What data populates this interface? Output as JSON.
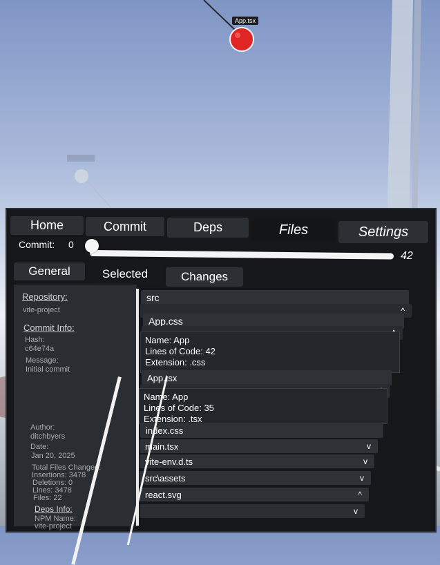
{
  "scene": {
    "node_label": "App.tsx",
    "node_color": "#e02525"
  },
  "nav": {
    "home": "Home",
    "commit": "Commit",
    "deps": "Deps",
    "files": "Files",
    "settings": "Settings"
  },
  "commit_slider": {
    "label": "Commit:",
    "value": "0",
    "max": "42",
    "progress": 0
  },
  "sub_tabs": {
    "general": "General",
    "selected": "Selected",
    "changes": "Changes"
  },
  "info": {
    "repository_heading": "Repository:",
    "repository_name": "vite-project",
    "commit_info_heading": "Commit Info:",
    "hash_label": "Hash:",
    "hash_value": "c64e74a",
    "message_label": "Message:",
    "message_value": "Initial commit",
    "author_label": "Author:",
    "author_value": "ditchbyers",
    "date_label": "Date:",
    "date_value": "Jan 20, 2025",
    "total_files_changed": "Total Files Changed:",
    "insertions": "Insertions: 3478",
    "deletions": "Deletions: 0",
    "lines": "Lines: 3478",
    "files": "Files: 22",
    "deps_heading": "Deps Info:",
    "npm_name_label": "NPM Name:",
    "npm_name_value": "vite-project"
  },
  "tree": {
    "src": "src",
    "app_css": "App.css",
    "app_css_name": "Name: App",
    "app_css_loc": "Lines of Code: 42",
    "app_css_ext": "Extension: .css",
    "app_tsx": "App.tsx",
    "app_tsx_name": "Name: App",
    "app_tsx_loc": "Lines of Code: 35",
    "app_tsx_ext": "Extension: .tsx",
    "index_css": "index.css",
    "main_tsx": "main.tsx",
    "vite_env": "vite-env.d.ts",
    "src_assets": "src\\assets",
    "react_svg": "react.svg",
    "chevron_up": "^",
    "chevron_down": "v"
  }
}
